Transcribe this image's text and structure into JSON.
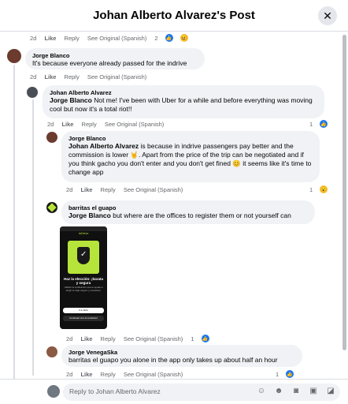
{
  "header": {
    "title": "Johan Alberto Alvarez's Post",
    "close_icon": "close-icon"
  },
  "meta_common": {
    "like": "Like",
    "reply": "Reply",
    "see_original": "See Original (Spanish)"
  },
  "top_meta": {
    "time": "2d",
    "count": "2"
  },
  "comments": [
    {
      "author": "Jorge Blanco",
      "text": "It's because everyone already passed for the indrive",
      "time": "2d"
    },
    {
      "author": "Johan Alberto Alvarez",
      "mention": "Jorge Blanco",
      "text": " Not me! I've been with Uber for a while and before everything was moving cool but now it's a total riot!!",
      "time": "2d",
      "count": "1"
    },
    {
      "author": "Jorge Blanco",
      "mention": "Johan Alberto Alvarez",
      "text": " is because in indrive passengers pay better and the commission is lower 🤘. Apart from the price of the trip can be negotiated and if you think gacho you don't enter and you don't get fined 😊 it seems like it's time to change app",
      "time": "2d",
      "count": "1"
    },
    {
      "author": "barritas el guapo",
      "mention": "Jorge Blanco",
      "text": " but where are the offices to register them or not yourself can",
      "time": "2d",
      "count": "1"
    },
    {
      "author": "Jorge VenegaSka",
      "text": "barritas el guapo you alone in the app only takes up about half an hour",
      "time": "2d",
      "count": "1"
    }
  ],
  "image_text": {
    "brand": "inDrive",
    "headline": "Haz la elección: ¡barata y segura",
    "body": "Utilizar la verificación que te ayude a elegir el viaje seguro y conductor.",
    "cta1": "Ir a inicio",
    "cta2": "Continuar con el conductor"
  },
  "reply_bar": {
    "placeholder": "Reply to Johan Alberto Alvarez"
  },
  "colors": {
    "accent": "#1877f2",
    "bubble_bg": "#f0f2f5",
    "meta_text": "#65676b"
  }
}
